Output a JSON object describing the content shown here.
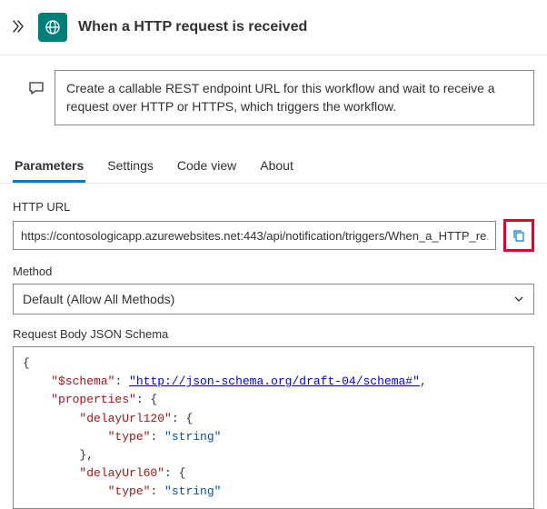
{
  "header": {
    "title": "When a HTTP request is received",
    "icon": "globe-icon"
  },
  "info": {
    "text": "Create a callable REST endpoint URL for this workflow and wait to receive a request over HTTP or HTTPS, which triggers the workflow."
  },
  "tabs": [
    {
      "id": "parameters",
      "label": "Parameters",
      "active": true
    },
    {
      "id": "settings",
      "label": "Settings",
      "active": false
    },
    {
      "id": "codeview",
      "label": "Code view",
      "active": false
    },
    {
      "id": "about",
      "label": "About",
      "active": false
    }
  ],
  "fields": {
    "httpUrl": {
      "label": "HTTP URL",
      "value": "https://contosologicapp.azurewebsites.net:443/api/notification/triggers/When_a_HTTP_re..."
    },
    "method": {
      "label": "Method",
      "value": "Default (Allow All Methods)"
    },
    "schema": {
      "label": "Request Body JSON Schema",
      "lines": {
        "l0": "{",
        "l1k": "\"$schema\"",
        "l1v": "\"http://json-schema.org/draft-04/schema#\"",
        "l2k": "\"properties\"",
        "l3k": "\"delayUrl120\"",
        "l4k": "\"type\"",
        "l4v": "\"string\"",
        "l6k": "\"delayUrl60\"",
        "l7k": "\"type\"",
        "l7v": "\"string\""
      }
    }
  }
}
